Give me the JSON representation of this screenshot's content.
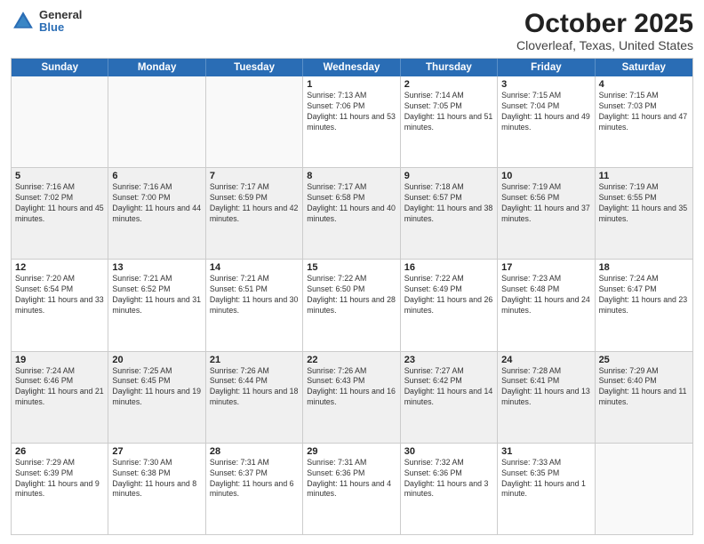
{
  "header": {
    "logo": {
      "general": "General",
      "blue": "Blue"
    },
    "title": "October 2025",
    "location": "Cloverleaf, Texas, United States"
  },
  "days_of_week": [
    "Sunday",
    "Monday",
    "Tuesday",
    "Wednesday",
    "Thursday",
    "Friday",
    "Saturday"
  ],
  "weeks": [
    [
      {
        "day": "",
        "sunrise": "",
        "sunset": "",
        "daylight": ""
      },
      {
        "day": "",
        "sunrise": "",
        "sunset": "",
        "daylight": ""
      },
      {
        "day": "",
        "sunrise": "",
        "sunset": "",
        "daylight": ""
      },
      {
        "day": "1",
        "sunrise": "Sunrise: 7:13 AM",
        "sunset": "Sunset: 7:06 PM",
        "daylight": "Daylight: 11 hours and 53 minutes."
      },
      {
        "day": "2",
        "sunrise": "Sunrise: 7:14 AM",
        "sunset": "Sunset: 7:05 PM",
        "daylight": "Daylight: 11 hours and 51 minutes."
      },
      {
        "day": "3",
        "sunrise": "Sunrise: 7:15 AM",
        "sunset": "Sunset: 7:04 PM",
        "daylight": "Daylight: 11 hours and 49 minutes."
      },
      {
        "day": "4",
        "sunrise": "Sunrise: 7:15 AM",
        "sunset": "Sunset: 7:03 PM",
        "daylight": "Daylight: 11 hours and 47 minutes."
      }
    ],
    [
      {
        "day": "5",
        "sunrise": "Sunrise: 7:16 AM",
        "sunset": "Sunset: 7:02 PM",
        "daylight": "Daylight: 11 hours and 45 minutes."
      },
      {
        "day": "6",
        "sunrise": "Sunrise: 7:16 AM",
        "sunset": "Sunset: 7:00 PM",
        "daylight": "Daylight: 11 hours and 44 minutes."
      },
      {
        "day": "7",
        "sunrise": "Sunrise: 7:17 AM",
        "sunset": "Sunset: 6:59 PM",
        "daylight": "Daylight: 11 hours and 42 minutes."
      },
      {
        "day": "8",
        "sunrise": "Sunrise: 7:17 AM",
        "sunset": "Sunset: 6:58 PM",
        "daylight": "Daylight: 11 hours and 40 minutes."
      },
      {
        "day": "9",
        "sunrise": "Sunrise: 7:18 AM",
        "sunset": "Sunset: 6:57 PM",
        "daylight": "Daylight: 11 hours and 38 minutes."
      },
      {
        "day": "10",
        "sunrise": "Sunrise: 7:19 AM",
        "sunset": "Sunset: 6:56 PM",
        "daylight": "Daylight: 11 hours and 37 minutes."
      },
      {
        "day": "11",
        "sunrise": "Sunrise: 7:19 AM",
        "sunset": "Sunset: 6:55 PM",
        "daylight": "Daylight: 11 hours and 35 minutes."
      }
    ],
    [
      {
        "day": "12",
        "sunrise": "Sunrise: 7:20 AM",
        "sunset": "Sunset: 6:54 PM",
        "daylight": "Daylight: 11 hours and 33 minutes."
      },
      {
        "day": "13",
        "sunrise": "Sunrise: 7:21 AM",
        "sunset": "Sunset: 6:52 PM",
        "daylight": "Daylight: 11 hours and 31 minutes."
      },
      {
        "day": "14",
        "sunrise": "Sunrise: 7:21 AM",
        "sunset": "Sunset: 6:51 PM",
        "daylight": "Daylight: 11 hours and 30 minutes."
      },
      {
        "day": "15",
        "sunrise": "Sunrise: 7:22 AM",
        "sunset": "Sunset: 6:50 PM",
        "daylight": "Daylight: 11 hours and 28 minutes."
      },
      {
        "day": "16",
        "sunrise": "Sunrise: 7:22 AM",
        "sunset": "Sunset: 6:49 PM",
        "daylight": "Daylight: 11 hours and 26 minutes."
      },
      {
        "day": "17",
        "sunrise": "Sunrise: 7:23 AM",
        "sunset": "Sunset: 6:48 PM",
        "daylight": "Daylight: 11 hours and 24 minutes."
      },
      {
        "day": "18",
        "sunrise": "Sunrise: 7:24 AM",
        "sunset": "Sunset: 6:47 PM",
        "daylight": "Daylight: 11 hours and 23 minutes."
      }
    ],
    [
      {
        "day": "19",
        "sunrise": "Sunrise: 7:24 AM",
        "sunset": "Sunset: 6:46 PM",
        "daylight": "Daylight: 11 hours and 21 minutes."
      },
      {
        "day": "20",
        "sunrise": "Sunrise: 7:25 AM",
        "sunset": "Sunset: 6:45 PM",
        "daylight": "Daylight: 11 hours and 19 minutes."
      },
      {
        "day": "21",
        "sunrise": "Sunrise: 7:26 AM",
        "sunset": "Sunset: 6:44 PM",
        "daylight": "Daylight: 11 hours and 18 minutes."
      },
      {
        "day": "22",
        "sunrise": "Sunrise: 7:26 AM",
        "sunset": "Sunset: 6:43 PM",
        "daylight": "Daylight: 11 hours and 16 minutes."
      },
      {
        "day": "23",
        "sunrise": "Sunrise: 7:27 AM",
        "sunset": "Sunset: 6:42 PM",
        "daylight": "Daylight: 11 hours and 14 minutes."
      },
      {
        "day": "24",
        "sunrise": "Sunrise: 7:28 AM",
        "sunset": "Sunset: 6:41 PM",
        "daylight": "Daylight: 11 hours and 13 minutes."
      },
      {
        "day": "25",
        "sunrise": "Sunrise: 7:29 AM",
        "sunset": "Sunset: 6:40 PM",
        "daylight": "Daylight: 11 hours and 11 minutes."
      }
    ],
    [
      {
        "day": "26",
        "sunrise": "Sunrise: 7:29 AM",
        "sunset": "Sunset: 6:39 PM",
        "daylight": "Daylight: 11 hours and 9 minutes."
      },
      {
        "day": "27",
        "sunrise": "Sunrise: 7:30 AM",
        "sunset": "Sunset: 6:38 PM",
        "daylight": "Daylight: 11 hours and 8 minutes."
      },
      {
        "day": "28",
        "sunrise": "Sunrise: 7:31 AM",
        "sunset": "Sunset: 6:37 PM",
        "daylight": "Daylight: 11 hours and 6 minutes."
      },
      {
        "day": "29",
        "sunrise": "Sunrise: 7:31 AM",
        "sunset": "Sunset: 6:36 PM",
        "daylight": "Daylight: 11 hours and 4 minutes."
      },
      {
        "day": "30",
        "sunrise": "Sunrise: 7:32 AM",
        "sunset": "Sunset: 6:36 PM",
        "daylight": "Daylight: 11 hours and 3 minutes."
      },
      {
        "day": "31",
        "sunrise": "Sunrise: 7:33 AM",
        "sunset": "Sunset: 6:35 PM",
        "daylight": "Daylight: 11 hours and 1 minute."
      },
      {
        "day": "",
        "sunrise": "",
        "sunset": "",
        "daylight": ""
      }
    ]
  ]
}
